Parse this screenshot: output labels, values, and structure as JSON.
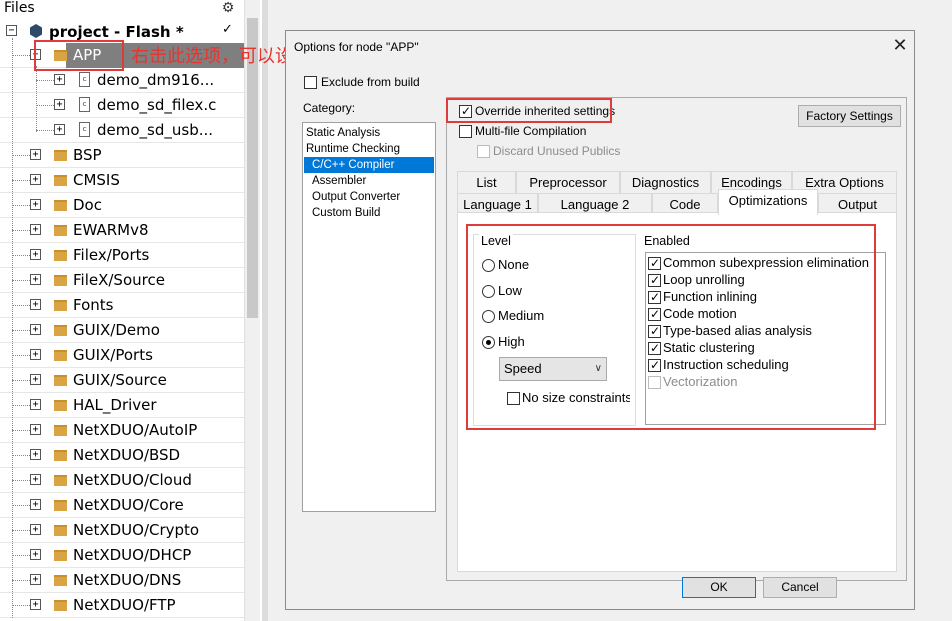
{
  "workspace": {
    "header": "Files",
    "root": {
      "label": "project - Flash *",
      "check": "✓"
    },
    "items": [
      {
        "label": "APP",
        "type": "folder",
        "level": 1,
        "expander": "−"
      },
      {
        "label": "demo_dm916...",
        "type": "file",
        "level": 2,
        "expander": "+"
      },
      {
        "label": "demo_sd_filex.c",
        "type": "file",
        "level": 2,
        "expander": "+"
      },
      {
        "label": "demo_sd_usb...",
        "type": "file",
        "level": 2,
        "expander": "+"
      },
      {
        "label": "BSP",
        "type": "folder",
        "level": 1,
        "expander": "+"
      },
      {
        "label": "CMSIS",
        "type": "folder",
        "level": 1,
        "expander": "+"
      },
      {
        "label": "Doc",
        "type": "folder",
        "level": 1,
        "expander": "+"
      },
      {
        "label": "EWARMv8",
        "type": "folder",
        "level": 1,
        "expander": "+"
      },
      {
        "label": "Filex/Ports",
        "type": "folder",
        "level": 1,
        "expander": "+"
      },
      {
        "label": "FileX/Source",
        "type": "folder",
        "level": 1,
        "expander": "+"
      },
      {
        "label": "Fonts",
        "type": "folder",
        "level": 1,
        "expander": "+"
      },
      {
        "label": "GUIX/Demo",
        "type": "folder",
        "level": 1,
        "expander": "+"
      },
      {
        "label": "GUIX/Ports",
        "type": "folder",
        "level": 1,
        "expander": "+"
      },
      {
        "label": "GUIX/Source",
        "type": "folder",
        "level": 1,
        "expander": "+"
      },
      {
        "label": "HAL_Driver",
        "type": "folder",
        "level": 1,
        "expander": "+"
      },
      {
        "label": "NetXDUO/AutoIP",
        "type": "folder",
        "level": 1,
        "expander": "+"
      },
      {
        "label": "NetXDUO/BSD",
        "type": "folder",
        "level": 1,
        "expander": "+"
      },
      {
        "label": "NetXDUO/Cloud",
        "type": "folder",
        "level": 1,
        "expander": "+"
      },
      {
        "label": "NetXDUO/Core",
        "type": "folder",
        "level": 1,
        "expander": "+"
      },
      {
        "label": "NetXDUO/Crypto",
        "type": "folder",
        "level": 1,
        "expander": "+"
      },
      {
        "label": "NetXDUO/DHCP",
        "type": "folder",
        "level": 1,
        "expander": "+"
      },
      {
        "label": "NetXDUO/DNS",
        "type": "folder",
        "level": 1,
        "expander": "+"
      },
      {
        "label": "NetXDUO/FTP",
        "type": "folder",
        "level": 1,
        "expander": "+"
      }
    ]
  },
  "annotation": {
    "text": "右击此选项，可以设置整个分组的优化等级，当然也可以设置单独某个文件",
    "color": "#e8342f"
  },
  "dialog": {
    "title": "Options for node \"APP\"",
    "close_glyph": "✕",
    "exclude_label": "Exclude from build",
    "category_label": "Category:",
    "categories": [
      "Static Analysis",
      "Runtime Checking",
      "C/C++ Compiler",
      "Assembler",
      "Output Converter",
      "Custom Build"
    ],
    "selected_category": "C/C++ Compiler",
    "override_label": "Override inherited settings",
    "override_checked": true,
    "multifile_label": "Multi-file Compilation",
    "discard_label": "Discard Unused Publics",
    "factory_label": "Factory Settings",
    "tabs_row1": [
      "List",
      "Preprocessor",
      "Diagnostics",
      "Encodings",
      "Extra Options"
    ],
    "tabs_row2": [
      "Language 1",
      "Language 2",
      "Code",
      "Optimizations",
      "Output"
    ],
    "active_tab": "Optimizations",
    "level": {
      "title": "Level",
      "options": [
        "None",
        "Low",
        "Medium",
        "High"
      ],
      "selected": "High",
      "strategy": "Speed",
      "no_size_label": "No size constraints"
    },
    "enabled": {
      "title": "Enabled",
      "options": [
        {
          "label": "Common subexpression elimination",
          "checked": true,
          "disabled": false
        },
        {
          "label": "Loop unrolling",
          "checked": true,
          "disabled": false
        },
        {
          "label": "Function inlining",
          "checked": true,
          "disabled": false
        },
        {
          "label": "Code motion",
          "checked": true,
          "disabled": false
        },
        {
          "label": "Type-based alias analysis",
          "checked": true,
          "disabled": false
        },
        {
          "label": "Static clustering",
          "checked": true,
          "disabled": false
        },
        {
          "label": "Instruction scheduling",
          "checked": true,
          "disabled": false
        },
        {
          "label": "Vectorization",
          "checked": false,
          "disabled": true
        }
      ]
    },
    "ok_label": "OK",
    "cancel_label": "Cancel"
  }
}
